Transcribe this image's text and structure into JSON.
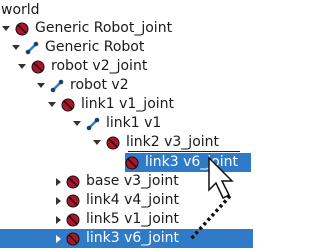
{
  "tree": {
    "root_label": "world",
    "rows": [
      {
        "label": "Generic Robot_joint",
        "icon": "joint-icon",
        "arrow": "down",
        "selected": false
      },
      {
        "label": "Generic Robot",
        "icon": "link-icon",
        "arrow": "down",
        "selected": false
      },
      {
        "label": "robot v2_joint",
        "icon": "joint-icon",
        "arrow": "down",
        "selected": false
      },
      {
        "label": "robot v2",
        "icon": "link-icon",
        "arrow": "down",
        "selected": false
      },
      {
        "label": "link1 v1_joint",
        "icon": "joint-icon",
        "arrow": "down",
        "selected": false
      },
      {
        "label": "link1 v1",
        "icon": "link-icon",
        "arrow": "down",
        "selected": false
      },
      {
        "label": "link2 v3_joint",
        "icon": "joint-icon",
        "arrow": "down",
        "selected": false
      },
      {
        "label": "base v3_joint",
        "icon": "joint-icon",
        "arrow": "right",
        "selected": false
      },
      {
        "label": "link4 v4_joint",
        "icon": "joint-icon",
        "arrow": "right",
        "selected": false
      },
      {
        "label": "link5 v1_joint",
        "icon": "joint-icon",
        "arrow": "right",
        "selected": false
      },
      {
        "label": "link3 v6_joint",
        "icon": "joint-icon",
        "arrow": "right",
        "selected": true
      }
    ],
    "drag_ghost": {
      "label": "link3 v6_joint",
      "icon": "joint-icon"
    }
  },
  "colors": {
    "selection": "#2f7bc7",
    "joint_fill": "#b0122a",
    "link_fill": "#2f7bc7"
  },
  "icons": [
    "joint-icon",
    "link-icon",
    "cursor-arrow-icon",
    "drag-path-icon"
  ]
}
